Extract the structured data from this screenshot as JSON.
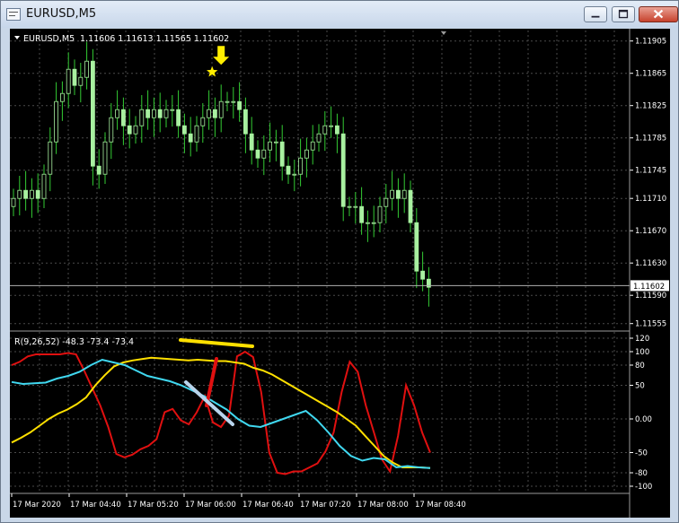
{
  "window": {
    "title": "EURUSD,M5",
    "buttons": {
      "minimize": "minimize",
      "maximize": "maximize",
      "close": "close"
    }
  },
  "price_header": {
    "symbol": "EURUSD,M5",
    "ohlc": "1.11606 1.11613 1.11565 1.11602"
  },
  "indicator_header": {
    "label": "R(9,26,52) -48.3 -73.4 -73.4"
  },
  "colors": {
    "background": "#000000",
    "grid": "#4a4a4a",
    "candle": "#a8f0a0",
    "wick": "#33cc33",
    "arrow": "#ffee00",
    "red_line": "#e01010",
    "yellow_line": "#ffe000",
    "cyan_line": "#40d8f0",
    "text": "#ffffff"
  },
  "chart_data": [
    {
      "type": "candlestick",
      "symbol": "EURUSD",
      "timeframe": "M5",
      "ylim": [
        1.11548,
        1.11918
      ],
      "yticks": [
        1.11905,
        1.11865,
        1.11825,
        1.11785,
        1.11745,
        1.1171,
        1.1167,
        1.1163,
        1.1159,
        1.11555
      ],
      "ytick_labels": [
        "1.11905",
        "1.11865",
        "1.11825",
        "1.11785",
        "1.11745",
        "1.11710",
        "1.11670",
        "1.11630",
        "1.11590",
        "1.11555"
      ],
      "current_price": "1.11602",
      "marker": {
        "type": "down-arrow-and-star",
        "color": "#ffee00",
        "bar_index": 34
      },
      "closes": [
        1.1171,
        1.1172,
        1.1171,
        1.1172,
        1.1171,
        1.1174,
        1.1178,
        1.1183,
        1.1184,
        1.1187,
        1.1185,
        1.1186,
        1.1188,
        1.1175,
        1.1174,
        1.1178,
        1.1181,
        1.1182,
        1.118,
        1.1179,
        1.118,
        1.1182,
        1.1181,
        1.1182,
        1.1181,
        1.1182,
        1.1182,
        1.118,
        1.1179,
        1.1178,
        1.118,
        1.1181,
        1.1182,
        1.1181,
        1.1183,
        1.1183,
        1.1183,
        1.1182,
        1.1179,
        1.1177,
        1.1176,
        1.1177,
        1.1178,
        1.1178,
        1.1175,
        1.1174,
        1.1174,
        1.1176,
        1.1177,
        1.1178,
        1.1179,
        1.118,
        1.118,
        1.1179,
        1.117,
        1.117,
        1.117,
        1.1168,
        1.1168,
        1.1168,
        1.117,
        1.1171,
        1.1172,
        1.1171,
        1.1172,
        1.1168,
        1.1162,
        1.1161,
        1.116
      ],
      "series": []
    },
    {
      "type": "line",
      "title": "R(9,26,52) -48.3 -73.4 -73.4",
      "ylim": [
        -108,
        128
      ],
      "yticks": [
        120,
        100,
        80,
        50,
        0,
        -50,
        -80,
        -100
      ],
      "ytick_labels": [
        "120",
        "100",
        "80",
        "50",
        "0.00",
        "-50",
        "-80",
        "-100"
      ],
      "x_labels": [
        "17 Mar 2020",
        "17 Mar 04:40",
        "17 Mar 05:20",
        "17 Mar 06:00",
        "17 Mar 06:40",
        "17 Mar 07:20",
        "17 Mar 08:00",
        "17 Mar 08:40"
      ],
      "series": [
        {
          "color": "#e01010",
          "values": [
            80,
            85,
            93,
            96,
            96,
            96,
            96,
            98,
            96,
            72,
            46,
            20,
            -12,
            -52,
            -57,
            -53,
            -45,
            -40,
            -30,
            10,
            15,
            -2,
            -8,
            10,
            34,
            -5,
            -12,
            5,
            93,
            100,
            92,
            40,
            -50,
            -80,
            -82,
            -78,
            -78,
            -72,
            -66,
            -48,
            -20,
            40,
            85,
            70,
            20,
            -20,
            -60,
            -78,
            -25,
            50,
            20,
            -20,
            -50
          ]
        },
        {
          "color": "#ffe000",
          "values": [
            -35,
            -28,
            -20,
            -10,
            0,
            8,
            14,
            22,
            32,
            50,
            65,
            78,
            84,
            87,
            89,
            91,
            90,
            89,
            88,
            87,
            88,
            87,
            86,
            86,
            84,
            82,
            76,
            72,
            66,
            58,
            50,
            42,
            34,
            26,
            18,
            10,
            0,
            -10,
            -25,
            -40,
            -55,
            -65,
            -72,
            -72,
            -72,
            -73
          ]
        },
        {
          "color": "#40d8f0",
          "values": [
            55,
            52,
            53,
            54,
            60,
            64,
            70,
            80,
            88,
            84,
            80,
            72,
            64,
            60,
            56,
            50,
            42,
            34,
            24,
            14,
            0,
            -10,
            -12,
            -6,
            0,
            6,
            12,
            -2,
            -20,
            -40,
            -55,
            -62,
            -58,
            -60,
            -72,
            -70,
            -72,
            -73
          ]
        }
      ]
    }
  ],
  "overlays": {
    "drawings": [
      "yellow-trend-line",
      "red-slash-line",
      "light-blue-diagonal-line"
    ]
  }
}
